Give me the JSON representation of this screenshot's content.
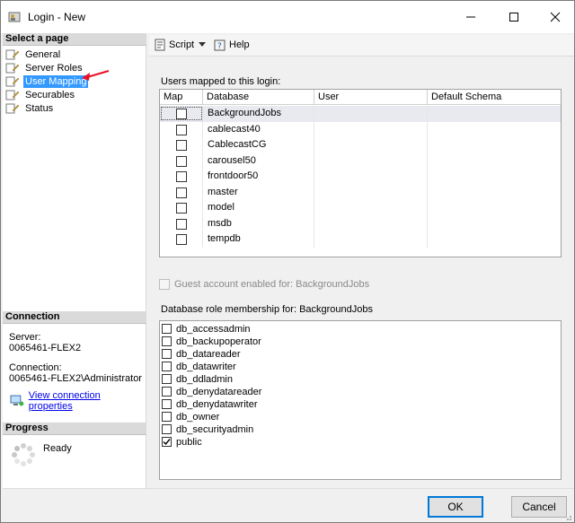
{
  "window": {
    "title": "Login - New"
  },
  "left": {
    "select_page_header": "Select a page",
    "pages": [
      {
        "label": "General",
        "selected": false
      },
      {
        "label": "Server Roles",
        "selected": false
      },
      {
        "label": "User Mapping",
        "selected": true
      },
      {
        "label": "Securables",
        "selected": false
      },
      {
        "label": "Status",
        "selected": false
      }
    ],
    "connection_header": "Connection",
    "server_label": "Server:",
    "server_value": "0065461-FLEX2",
    "connection_label": "Connection:",
    "connection_value": "0065461-FLEX2\\Administrator",
    "view_connection_link": "View connection properties",
    "progress_header": "Progress",
    "progress_status": "Ready"
  },
  "toolbar": {
    "script_label": "Script",
    "help_label": "Help"
  },
  "main": {
    "users_mapped_label": "Users mapped to this login:",
    "grid_headers": [
      "Map",
      "Database",
      "User",
      "Default Schema"
    ],
    "databases": [
      {
        "map": false,
        "database": "BackgroundJobs",
        "user": "",
        "schema": ""
      },
      {
        "map": false,
        "database": "cablecast40",
        "user": "",
        "schema": ""
      },
      {
        "map": false,
        "database": "CablecastCG",
        "user": "",
        "schema": ""
      },
      {
        "map": false,
        "database": "carousel50",
        "user": "",
        "schema": ""
      },
      {
        "map": false,
        "database": "frontdoor50",
        "user": "",
        "schema": ""
      },
      {
        "map": false,
        "database": "master",
        "user": "",
        "schema": ""
      },
      {
        "map": false,
        "database": "model",
        "user": "",
        "schema": ""
      },
      {
        "map": false,
        "database": "msdb",
        "user": "",
        "schema": ""
      },
      {
        "map": false,
        "database": "tempdb",
        "user": "",
        "schema": ""
      }
    ],
    "guest_label": "Guest account enabled for: BackgroundJobs",
    "guest_enabled": false,
    "role_membership_label": "Database role membership for: BackgroundJobs",
    "roles": [
      {
        "label": "db_accessadmin",
        "checked": false
      },
      {
        "label": "db_backupoperator",
        "checked": false
      },
      {
        "label": "db_datareader",
        "checked": false
      },
      {
        "label": "db_datawriter",
        "checked": false
      },
      {
        "label": "db_ddladmin",
        "checked": false
      },
      {
        "label": "db_denydatareader",
        "checked": false
      },
      {
        "label": "db_denydatawriter",
        "checked": false
      },
      {
        "label": "db_owner",
        "checked": false
      },
      {
        "label": "db_securityadmin",
        "checked": false
      },
      {
        "label": "public",
        "checked": true
      }
    ]
  },
  "buttons": {
    "ok": "OK",
    "cancel": "Cancel"
  },
  "colors": {
    "selection": "#3399ff",
    "link": "#0000ee",
    "arrow": "#e81123"
  }
}
